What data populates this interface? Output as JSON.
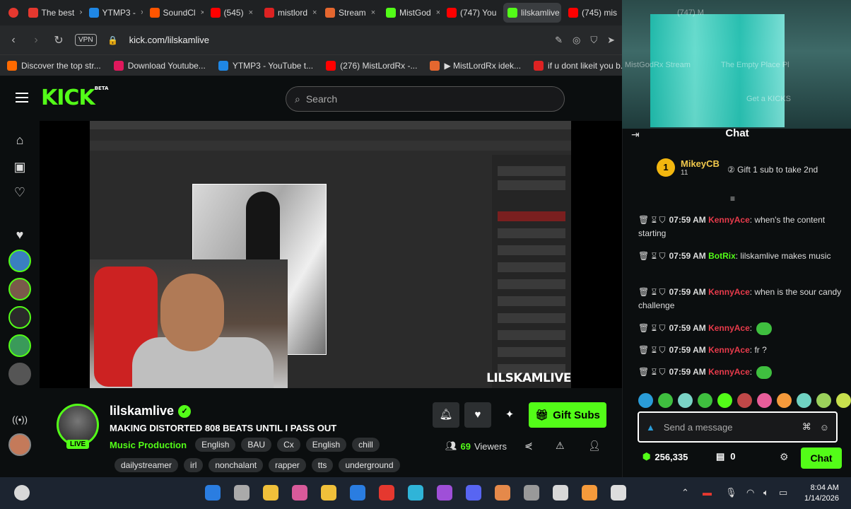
{
  "browser": {
    "tabs": [
      {
        "label": "The best",
        "icon": "opera-icon",
        "color": "#e5382f"
      },
      {
        "label": "YTMP3 -",
        "icon": "ytmp3-icon",
        "color": "#1f87e5"
      },
      {
        "label": "SoundCl",
        "icon": "soundcloud-icon",
        "color": "#ff5500"
      },
      {
        "label": "(545)",
        "icon": "youtube-icon",
        "color": "#ff0000"
      },
      {
        "label": "mistlord",
        "icon": "red-icon",
        "color": "#d22"
      },
      {
        "label": "Stream",
        "icon": "stream-icon",
        "color": "#e5672f"
      },
      {
        "label": "MistGod",
        "icon": "kick-icon",
        "color": "#53fc18"
      },
      {
        "label": "(747) You",
        "icon": "youtube-icon",
        "color": "#ff0000"
      },
      {
        "label": "lilskamlive",
        "icon": "kick-icon",
        "color": "#53fc18"
      },
      {
        "label": "(745) mis",
        "icon": "youtube-icon",
        "color": "#ff0000"
      }
    ],
    "url": "kick.com/lilskamlive",
    "vpn_label": "VPN",
    "bookmarks": [
      {
        "label": "Discover the top str...",
        "color": "#ff6a00"
      },
      {
        "label": "Download Youtube...",
        "color": "#e0185c"
      },
      {
        "label": "YTMP3 - YouTube t...",
        "color": "#1f87e5"
      },
      {
        "label": "(276) MistLordRx -...",
        "color": "#ff0000"
      },
      {
        "label": "▶ MistLordRx idek...",
        "color": "#e5672f"
      },
      {
        "label": "if u dont likeit you b...",
        "color": "#d22"
      }
    ]
  },
  "webcam": {
    "ghost_texts": [
      "MistGodRx Stream",
      "The Empty Place Pl",
      "Get a KICKS"
    ],
    "ghost_tab": "(747) M"
  },
  "kick": {
    "search_placeholder": "Search",
    "logo": "KICK",
    "logo_sup": "BETA",
    "video": {
      "watermark": "LILSKAMLIVE"
    },
    "stream": {
      "channel": "lilskamlive",
      "live": "LIVE",
      "title": "MAKING DISTORTED 808 BEATS UNTIL I PASS OUT",
      "category": "Music Production",
      "tags_row1": [
        "English",
        "BAU",
        "Cx",
        "English",
        "chill"
      ],
      "tags_row2": [
        "dailystreamer",
        "irl",
        "nonchalant",
        "rapper",
        "tts",
        "underground"
      ],
      "viewers_count": "69",
      "viewers_label": "Viewers",
      "gift_subs": "Gift Subs"
    }
  },
  "chat": {
    "title": "Chat",
    "pinned": {
      "rank": "1",
      "user": "MikeyCB",
      "sub_count": "11",
      "gift_text": "Gift 1 sub to take 2nd"
    },
    "messages": [
      {
        "time": "07:59 AM",
        "user": "KennyAce",
        "color": "#e83b4b",
        "text": ": when's the content starting"
      },
      {
        "time": "07:59 AM",
        "user": "BotRix",
        "color": "#53fc18",
        "text": ": lilskamlive makes music"
      },
      {
        "time": "07:59 AM",
        "user": "KennyAce",
        "color": "#e83b4b",
        "text": ": when is the sour candy challenge"
      },
      {
        "time": "07:59 AM",
        "user": "KennyAce",
        "color": "#e83b4b",
        "text": ":"
      },
      {
        "time": "07:59 AM",
        "user": "KennyAce",
        "color": "#e83b4b",
        "text": ": fr ?"
      },
      {
        "time": "07:59 AM",
        "user": "KennyAce",
        "color": "#e83b4b",
        "text": ":"
      }
    ],
    "emote_colors": [
      "#2a9cd8",
      "#3fbf3f",
      "#7ad3c6",
      "#3fbf3f",
      "#53fc18",
      "#c04848",
      "#e85d9a",
      "#f59a3b",
      "#6fd2c2",
      "#9bd15b",
      "#c8e04d",
      "#53fc18"
    ],
    "input_placeholder": "Send a message",
    "points": "256,335",
    "redeem_count": "0",
    "send_label": "Chat"
  },
  "taskbar": {
    "icon_colors": [
      "#2a7de1",
      "#aaaaaa",
      "#f0c03a",
      "#d85a9a",
      "#f0c03a",
      "#2a7de1",
      "#e5382f",
      "#2fb4d8",
      "#9f4fd8",
      "#5865f2",
      "#e5894a",
      "#999999",
      "#d8d8d8",
      "#f59a3b",
      "#dddddd"
    ],
    "time": "8:04 AM",
    "date": "1/14/2026"
  },
  "colors": {
    "accent": "#53fc18",
    "bg": "#0b0e0f"
  }
}
